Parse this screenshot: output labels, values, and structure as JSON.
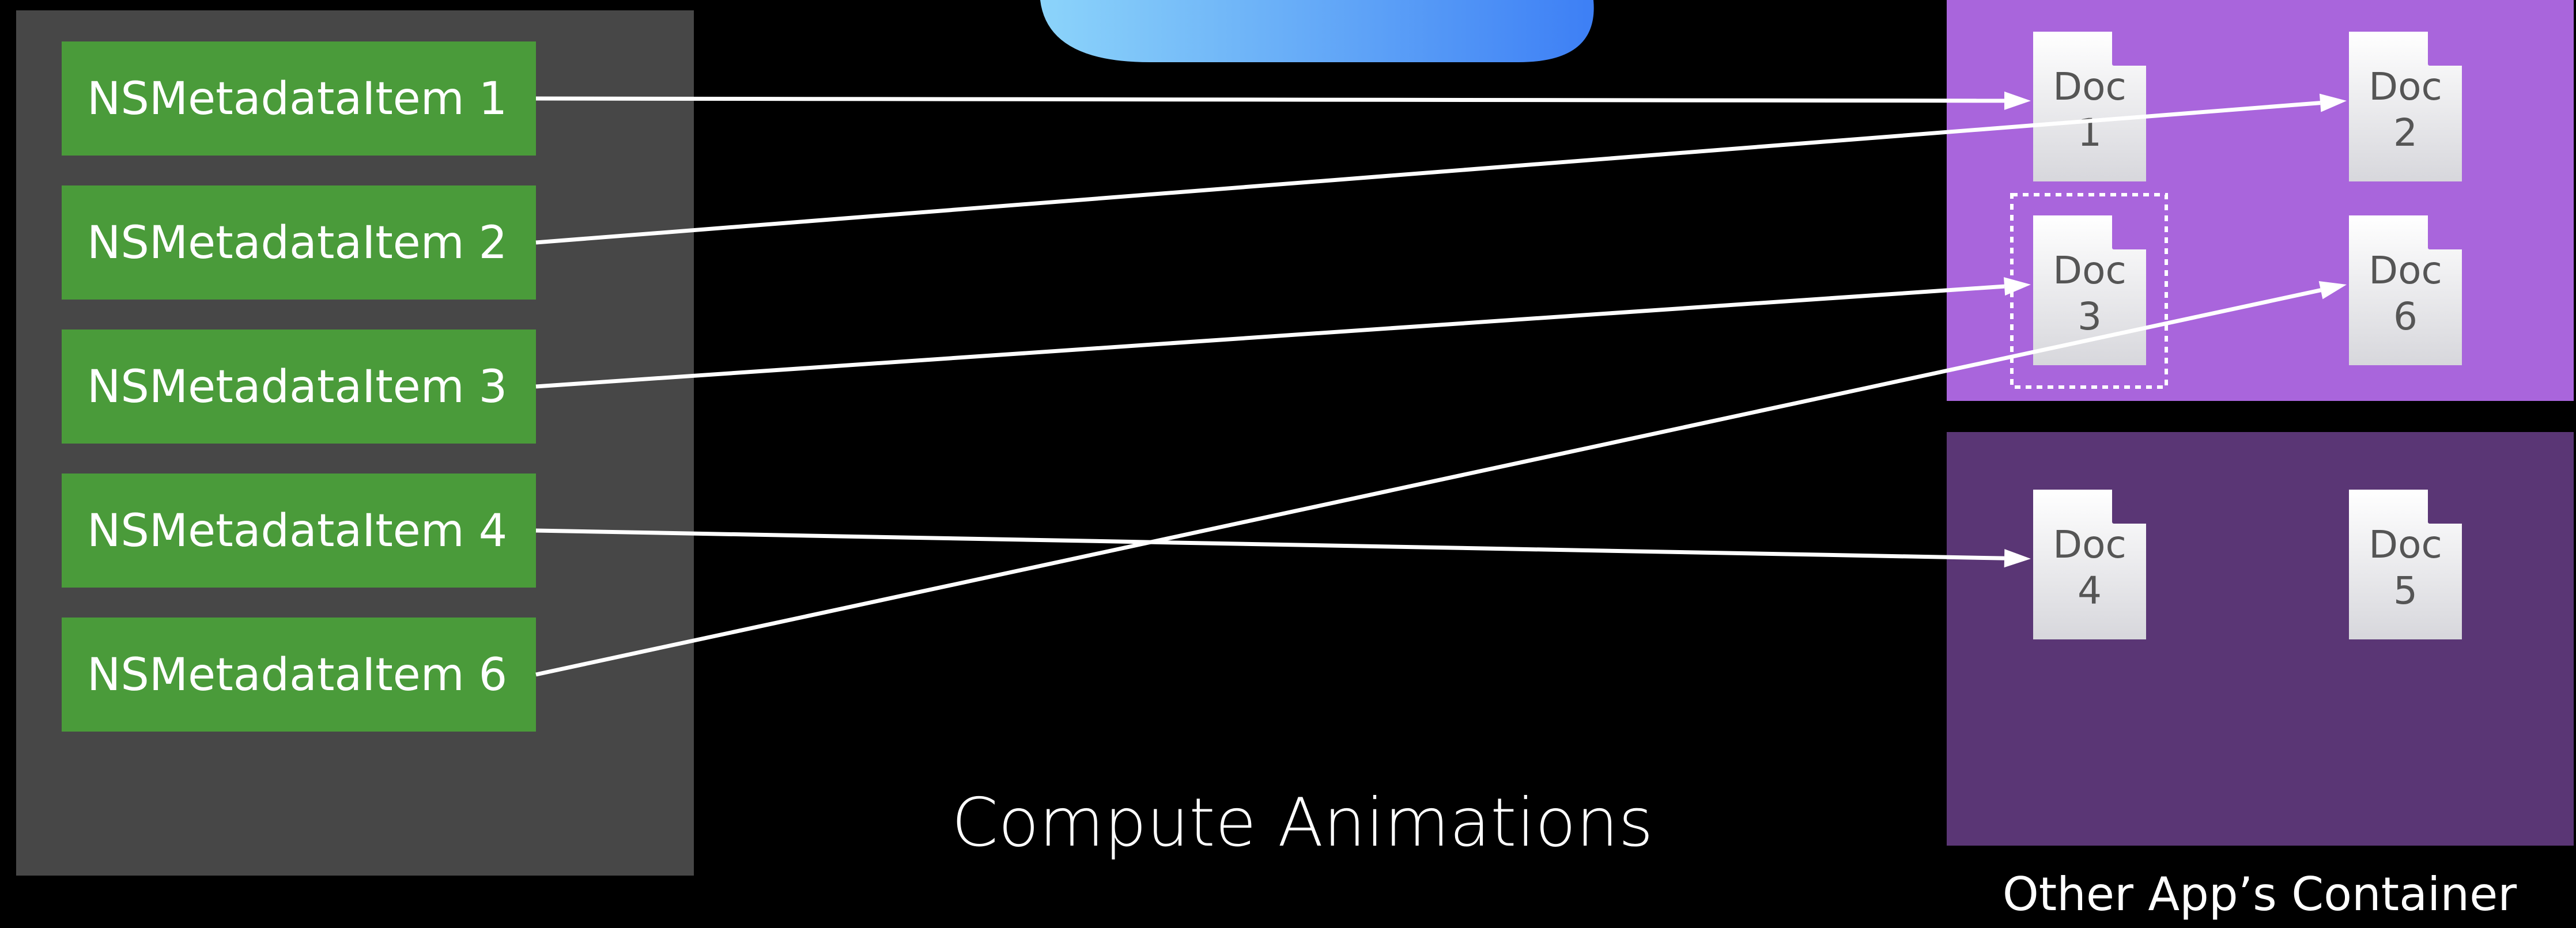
{
  "colors": {
    "background": "#000000",
    "list_panel": "#474747",
    "metadata_item": "#4a9b3a",
    "my_container": "#a965dc",
    "other_container": "#5a3675",
    "cloud_light": "#8cd4fa",
    "cloud_dark": "#3d7ff5",
    "doc_face_top": "#ffffff",
    "doc_face_bottom": "#d7d7dc",
    "doc_text": "#555555",
    "arrow": "#ffffff",
    "text": "#ffffff"
  },
  "metadata_items": [
    {
      "id": "m1",
      "label": "NSMetadataItem 1"
    },
    {
      "id": "m2",
      "label": "NSMetadataItem 2"
    },
    {
      "id": "m3",
      "label": "NSMetadataItem 3"
    },
    {
      "id": "m4",
      "label": "NSMetadataItem 4"
    },
    {
      "id": "m6",
      "label": "NSMetadataItem 6"
    }
  ],
  "documents": [
    {
      "id": "d1",
      "word": "Doc",
      "number": "1",
      "container": "mine"
    },
    {
      "id": "d2",
      "word": "Doc",
      "number": "2",
      "container": "mine"
    },
    {
      "id": "d3",
      "word": "Doc",
      "number": "3",
      "container": "mine",
      "selected": true
    },
    {
      "id": "d6",
      "word": "Doc",
      "number": "6",
      "container": "mine"
    },
    {
      "id": "d4",
      "word": "Doc",
      "number": "4",
      "container": "other"
    },
    {
      "id": "d5",
      "word": "Doc",
      "number": "5",
      "container": "other"
    }
  ],
  "links": [
    {
      "from": "m1",
      "to": "d1"
    },
    {
      "from": "m2",
      "to": "d2"
    },
    {
      "from": "m3",
      "to": "d3"
    },
    {
      "from": "m4",
      "to": "d4"
    },
    {
      "from": "m6",
      "to": "d6"
    }
  ],
  "caption": "Compute Animations",
  "other_container_label": "Other App’s Container"
}
